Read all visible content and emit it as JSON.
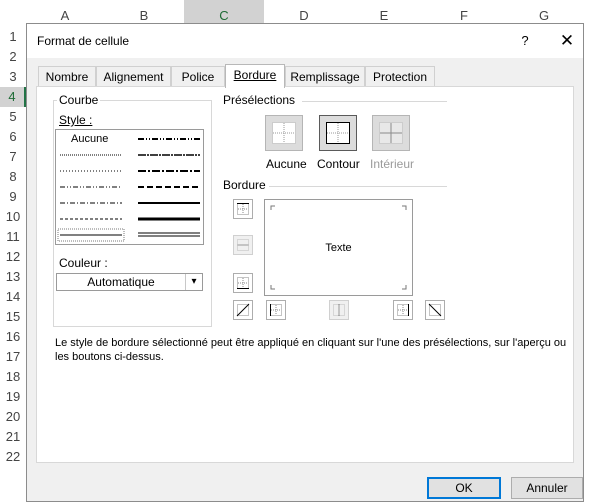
{
  "sheet": {
    "columns": [
      "A",
      "B",
      "C",
      "D",
      "E",
      "F",
      "G"
    ],
    "selected_column": "C",
    "rows": [
      "1",
      "2",
      "3",
      "4",
      "5",
      "6",
      "7",
      "8",
      "9",
      "10",
      "11",
      "12",
      "13",
      "14",
      "15",
      "16",
      "17",
      "18",
      "19",
      "20",
      "21",
      "22"
    ],
    "selected_row": "4"
  },
  "dialog": {
    "title": "Format de cellule",
    "help": "?",
    "close": "✕",
    "tabs": [
      {
        "label": "Nombre"
      },
      {
        "label": "Alignement"
      },
      {
        "label": "Police"
      },
      {
        "label": "Bordure"
      },
      {
        "label": "Remplissage"
      },
      {
        "label": "Protection"
      }
    ],
    "active_tab": "Bordure",
    "line_group": {
      "label": "Courbe",
      "style_label": "Style :",
      "none_label": "Aucune",
      "color_label": "Couleur :",
      "color_value": "Automatique"
    },
    "presets": {
      "label": "Présélections",
      "items": [
        {
          "label": "Aucune",
          "enabled": true
        },
        {
          "label": "Contour",
          "enabled": true
        },
        {
          "label": "Intérieur",
          "enabled": false
        }
      ]
    },
    "border": {
      "label": "Bordure",
      "preview_text": "Texte"
    },
    "note": "Le style de bordure sélectionné peut être appliqué en cliquant sur l'une des présélections, sur l'aperçu ou les boutons ci-dessus.",
    "ok": "OK",
    "cancel": "Annuler"
  }
}
